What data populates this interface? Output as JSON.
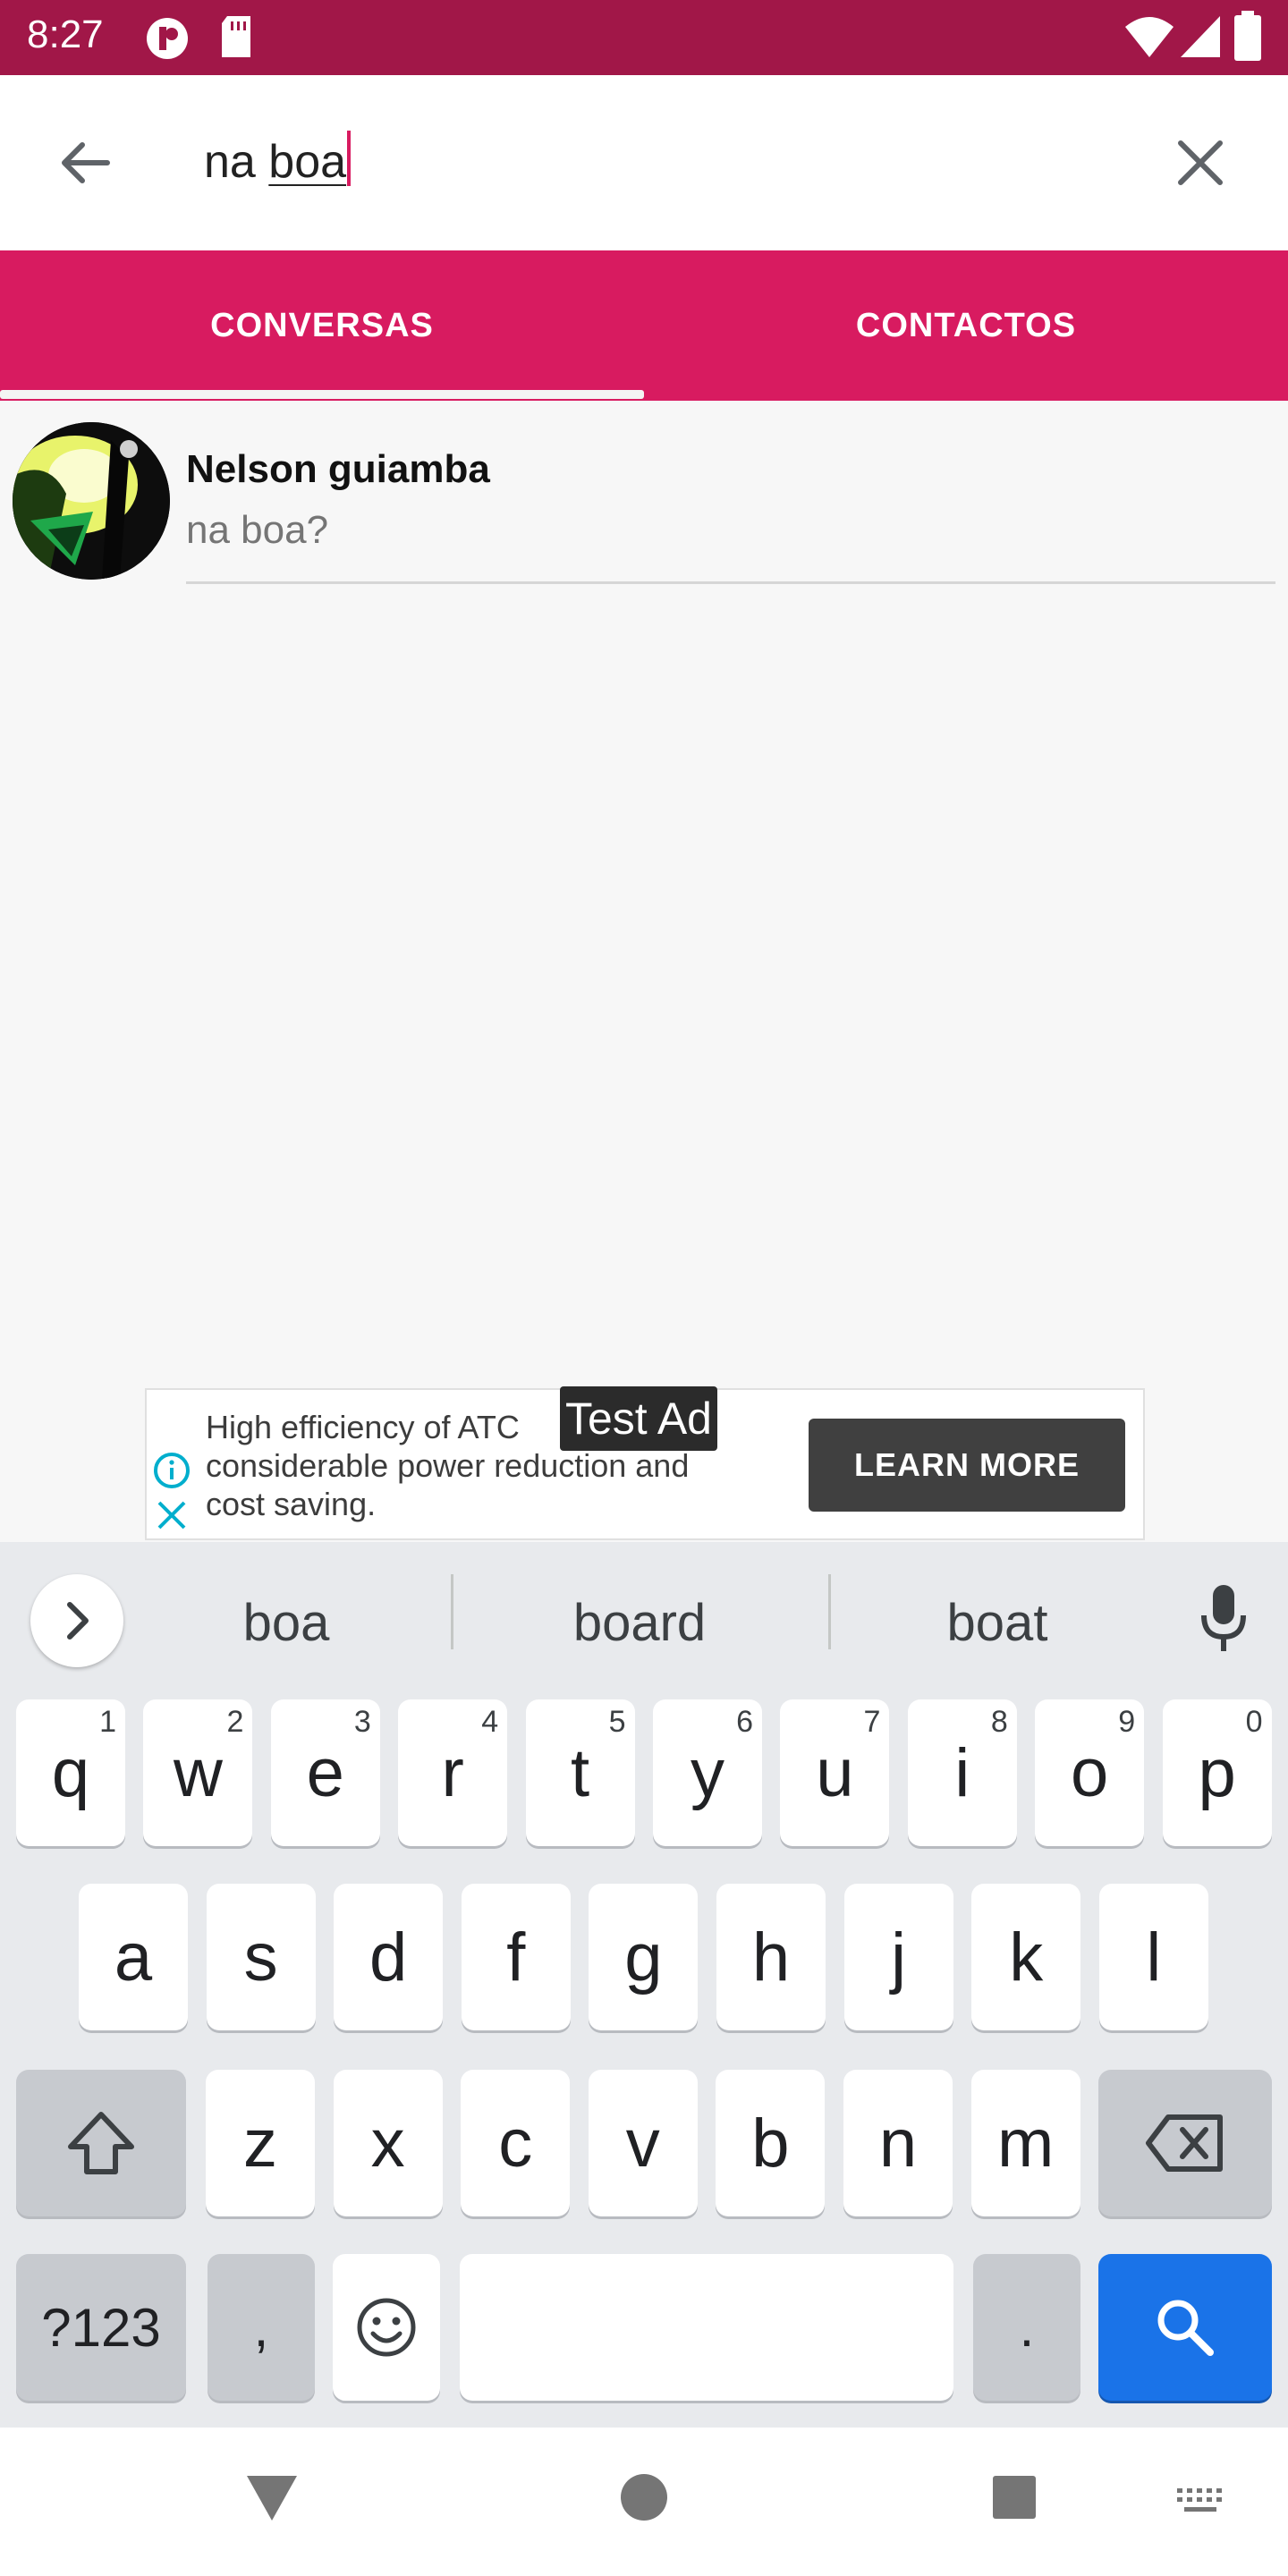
{
  "status_bar": {
    "time": "8:27",
    "color": "#a11748"
  },
  "search": {
    "query_prefix": "na ",
    "query_composing": "boa"
  },
  "tabs": [
    {
      "label": "CONVERSAS",
      "active": true
    },
    {
      "label": "CONTACTOS",
      "active": false
    }
  ],
  "accent_color": "#d81b60",
  "conversations": [
    {
      "name": "Nelson guiamba",
      "last_message": "na boa?"
    }
  ],
  "ad": {
    "line1": "High efficiency of ATC",
    "line2": "considerable power reduction and",
    "line3": "cost saving.",
    "button": "LEARN MORE",
    "badge": "Test Ad"
  },
  "keyboard": {
    "suggestions": [
      "boa",
      "board",
      "boat"
    ],
    "row1": [
      {
        "k": "q",
        "s": "1"
      },
      {
        "k": "w",
        "s": "2"
      },
      {
        "k": "e",
        "s": "3"
      },
      {
        "k": "r",
        "s": "4"
      },
      {
        "k": "t",
        "s": "5"
      },
      {
        "k": "y",
        "s": "6"
      },
      {
        "k": "u",
        "s": "7"
      },
      {
        "k": "i",
        "s": "8"
      },
      {
        "k": "o",
        "s": "9"
      },
      {
        "k": "p",
        "s": "0"
      }
    ],
    "row2": [
      "a",
      "s",
      "d",
      "f",
      "g",
      "h",
      "j",
      "k",
      "l"
    ],
    "row3": [
      "z",
      "x",
      "c",
      "v",
      "b",
      "n",
      "m"
    ],
    "symbols_label": "?123",
    "comma": ",",
    "period": "."
  }
}
